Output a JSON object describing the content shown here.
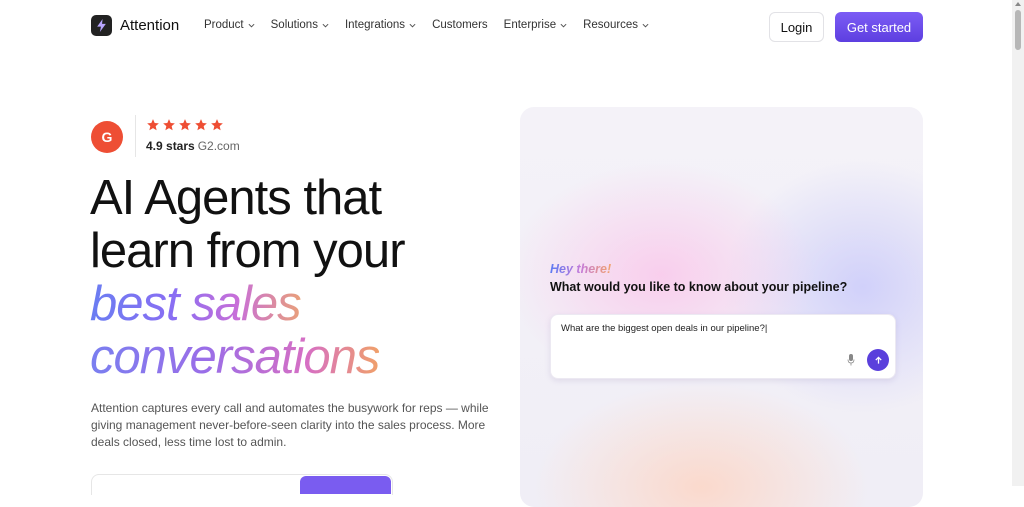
{
  "nav": {
    "logo_text": "Attention",
    "menu": [
      {
        "label": "Product",
        "has_dropdown": true
      },
      {
        "label": "Solutions",
        "has_dropdown": true
      },
      {
        "label": "Integrations",
        "has_dropdown": true
      },
      {
        "label": "Customers",
        "has_dropdown": false
      },
      {
        "label": "Enterprise",
        "has_dropdown": true
      },
      {
        "label": "Resources",
        "has_dropdown": true
      }
    ],
    "login_label": "Login",
    "cta_label": "Get started"
  },
  "rating": {
    "logo_text": "G",
    "stars": 5,
    "score": "4.9 stars",
    "source": "G2.com",
    "star_color": "#ee4e34"
  },
  "hero": {
    "headline_line1": "AI Agents that",
    "headline_line2": "learn from your",
    "headline_accent1": "best sales",
    "headline_accent2": "conversations",
    "description": "Attention captures every call and automates the busywork for reps — while giving management never-before-seen clarity into the sales process. More deals closed, less time lost to admin."
  },
  "chat_panel": {
    "greeting": "Hey there!",
    "question": "What would you like to know about your pipeline?",
    "input_value": "What are the biggest open deals in our pipeline?|",
    "mic_icon": "mic-icon",
    "send_icon": "arrow-up-icon",
    "accent_color": "#5a3fdc"
  }
}
